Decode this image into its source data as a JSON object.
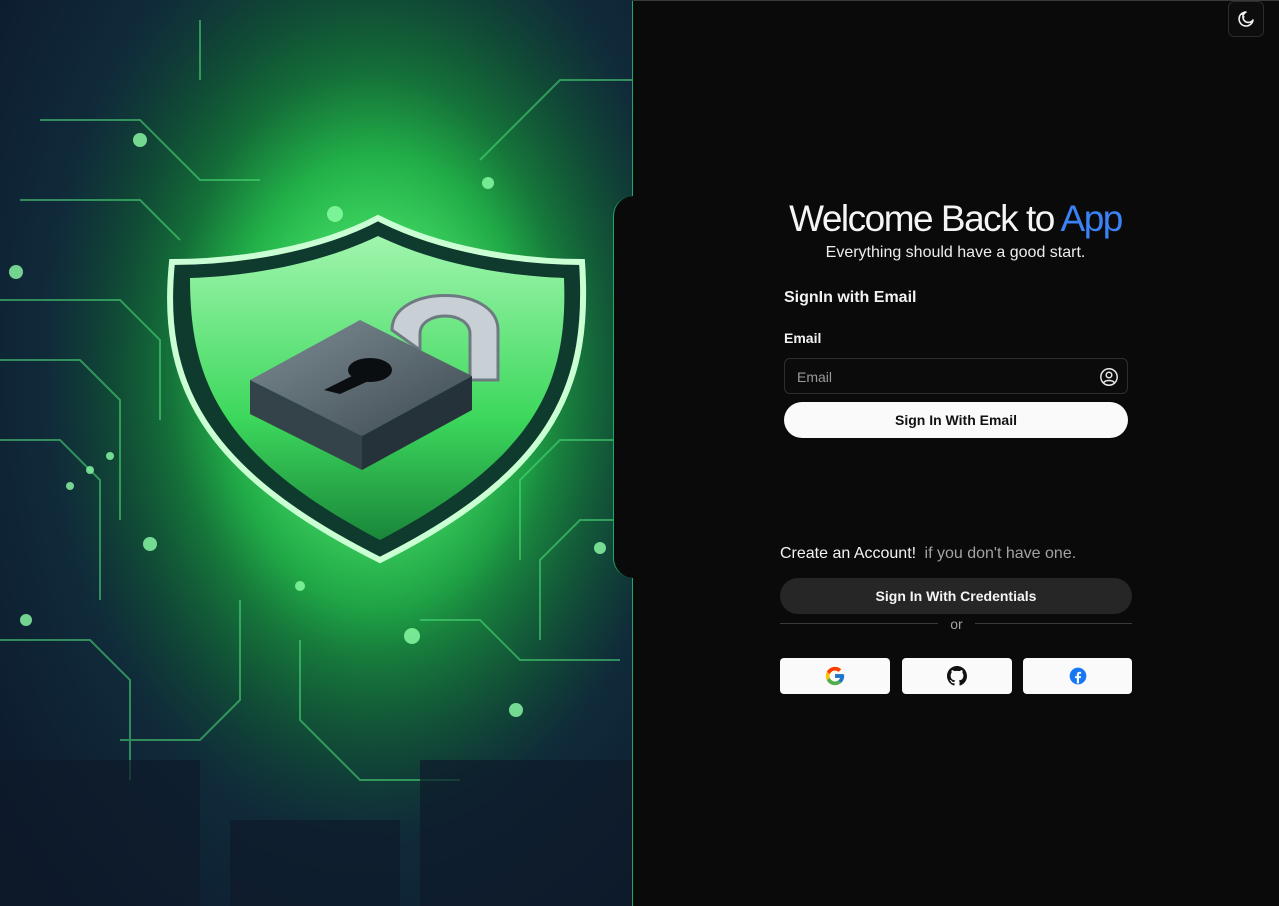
{
  "hero": {
    "image": "security-shield-padlock-circuit-board"
  },
  "theme_toggle": {
    "icon": "moon-stars-icon"
  },
  "header": {
    "title_main": "Welcome Back to",
    "title_accent": "App",
    "subtitle": "Everything should have a good start."
  },
  "email_form": {
    "section_title": "SignIn with Email",
    "email_label": "Email",
    "email_placeholder": "Email",
    "email_value": "",
    "submit_label": "Sign In With Email"
  },
  "account": {
    "create_text": "Create an Account!",
    "create_hint": "if you don't have one.",
    "credentials_label": "Sign In With Credentials",
    "divider_text": "or"
  },
  "social": [
    {
      "provider": "google",
      "icon": "google-icon"
    },
    {
      "provider": "github",
      "icon": "github-icon"
    },
    {
      "provider": "facebook",
      "icon": "facebook-icon"
    }
  ],
  "colors": {
    "background": "#0a0a0a",
    "accent": "#3b82f6",
    "hero_green": "#39e65a"
  }
}
